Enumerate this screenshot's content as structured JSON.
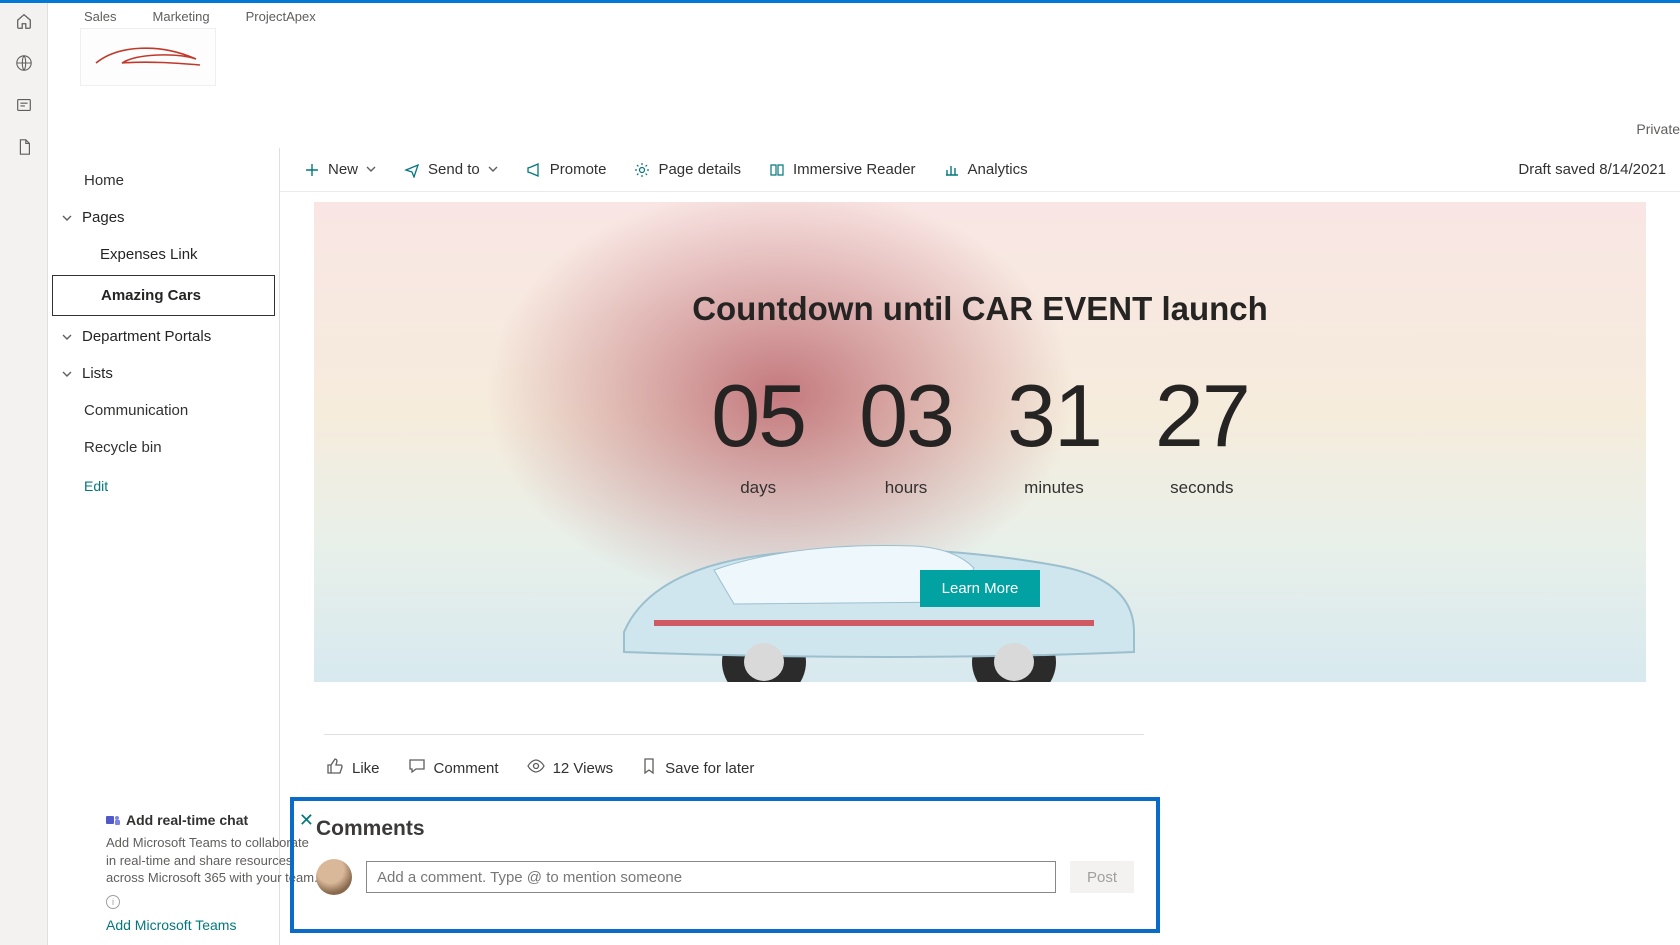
{
  "topTabs": [
    "Sales",
    "Marketing",
    "ProjectApex"
  ],
  "privacyLabel": "Private",
  "nav": {
    "home": "Home",
    "pages": "Pages",
    "expenses": "Expenses Link",
    "amazing": "Amazing Cars",
    "dept": "Department Portals",
    "lists": "Lists",
    "comm": "Communication",
    "recycle": "Recycle bin",
    "edit": "Edit"
  },
  "promo": {
    "title": "Add real-time chat",
    "body": "Add Microsoft Teams to collaborate in real-time and share resources across Microsoft 365 with your team.",
    "link": "Add Microsoft Teams"
  },
  "cmd": {
    "new": "New",
    "sendto": "Send to",
    "promote": "Promote",
    "details": "Page details",
    "immersive": "Immersive Reader",
    "analytics": "Analytics",
    "draft": "Draft saved 8/14/2021"
  },
  "hero": {
    "title": "Countdown until CAR EVENT launch",
    "days": "05",
    "hours": "03",
    "minutes": "31",
    "seconds": "27",
    "daysLbl": "days",
    "hoursLbl": "hours",
    "minutesLbl": "minutes",
    "secondsLbl": "seconds",
    "button": "Learn More"
  },
  "social": {
    "like": "Like",
    "comment": "Comment",
    "views": "12 Views",
    "save": "Save for later"
  },
  "comments": {
    "title": "Comments",
    "placeholder": "Add a comment. Type @ to mention someone",
    "post": "Post"
  }
}
